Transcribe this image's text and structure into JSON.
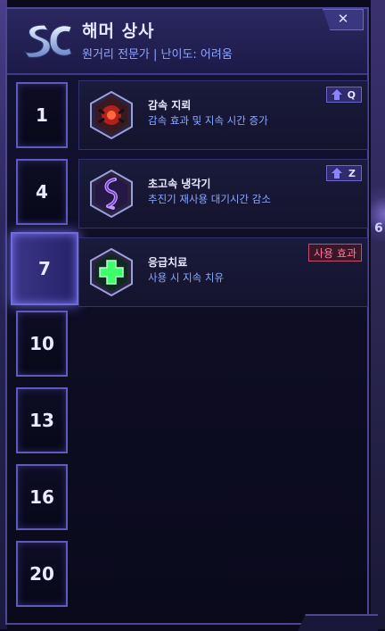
{
  "hero": {
    "name": "해머 상사",
    "role": "원거리 전문가 | 난이도: 어려움"
  },
  "close_label": "✕",
  "levels": [
    "1",
    "4",
    "7",
    "10",
    "13",
    "16",
    "20"
  ],
  "active_level_index": 2,
  "talents": [
    {
      "name": "감속 지뢰",
      "desc": "감속 효과 및 지속 시간 증가",
      "hotkey": "Q",
      "icon": "spider-mine-icon"
    },
    {
      "name": "초고속 냉각기",
      "desc": "추진기 재사용 대기시간 감소",
      "hotkey": "Z",
      "icon": "thruster-icon"
    },
    {
      "name": "응급치료",
      "desc": "사용 시 지속 치유",
      "badge": "사용 효과",
      "icon": "first-aid-icon"
    }
  ],
  "side_number": "6",
  "colors": {
    "accent": "#5f5bb8",
    "desc_text": "#87aaff",
    "active_badge": "#ff7894"
  }
}
